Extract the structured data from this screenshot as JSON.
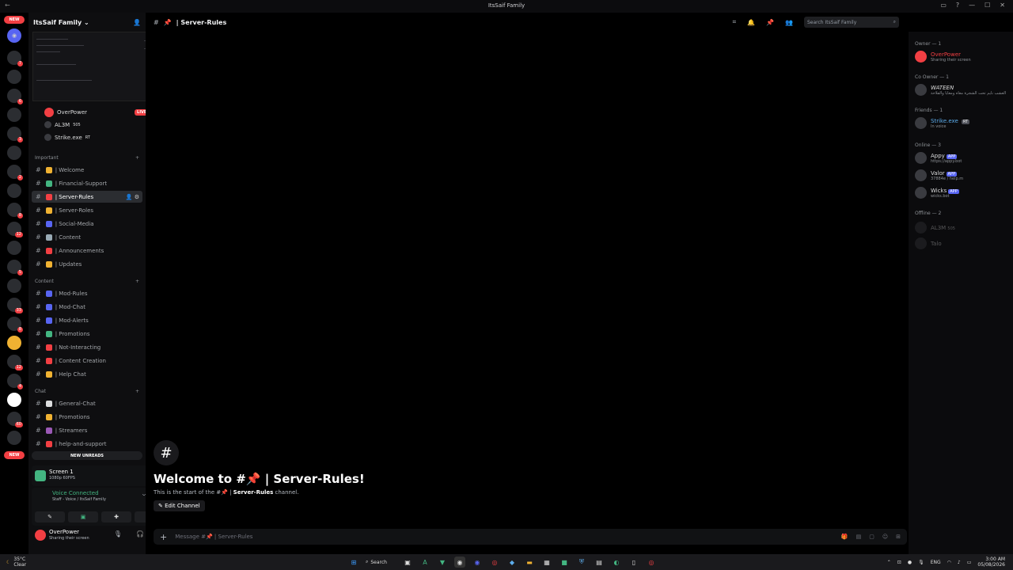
{
  "window": {
    "title": "ItsSaif Family"
  },
  "guilds": {
    "top_badge": "NEW",
    "bottom_badge": "NEW",
    "badges": [
      "7",
      "6",
      "3",
      "2",
      "8",
      "12",
      "5",
      "33",
      "8",
      "12",
      "4",
      "60"
    ]
  },
  "server": {
    "name": "ItsSaif Family"
  },
  "voice_users": [
    {
      "name": "OverPower",
      "badge": "LIVE"
    },
    {
      "name": "AL3M",
      "tag": "505"
    },
    {
      "name": "Strike.exe",
      "tag": "RT"
    }
  ],
  "categories": {
    "important": "Important",
    "content": "Content",
    "chat": "Chat"
  },
  "channels_important": [
    {
      "label": "| Welcome",
      "color": "#f0b232"
    },
    {
      "label": "| Financial-Support",
      "color": "#43b581"
    },
    {
      "label": "| Server-Rules",
      "color": "#f23f43",
      "active": true
    },
    {
      "label": "| Server-Roles",
      "color": "#f0b232"
    },
    {
      "label": "| Social-Media",
      "color": "#5865f2"
    },
    {
      "label": "| Content",
      "color": "#99aab5"
    },
    {
      "label": "| Announcements",
      "color": "#f23f43"
    },
    {
      "label": "| Updates",
      "color": "#f0b232"
    }
  ],
  "channels_content": [
    {
      "label": "| Mod-Rules",
      "color": "#5865f2"
    },
    {
      "label": "| Mod-Chat",
      "color": "#5865f2"
    },
    {
      "label": "| Mod-Alerts",
      "color": "#5865f2"
    },
    {
      "label": "| Promotions",
      "color": "#43b581"
    },
    {
      "label": "| Not-Interacting",
      "color": "#f23f43"
    },
    {
      "label": "| Content Creation",
      "color": "#f23f43"
    },
    {
      "label": "| Help Chat",
      "color": "#f0b232"
    }
  ],
  "channels_chat": [
    {
      "label": "| General-Chat",
      "color": "#dcddde"
    },
    {
      "label": "| Promotions",
      "color": "#f0b232"
    },
    {
      "label": "| Streamers",
      "color": "#9b59b6"
    },
    {
      "label": "| help-and-support",
      "color": "#f23f43"
    }
  ],
  "new_unreads": "NEW UNREADS",
  "screen_share": {
    "title": "Screen 1",
    "sub": "1080p 60FPS"
  },
  "voice_connected": {
    "status": "Voice Connected",
    "path": "Staff - Voice / ItsSaif Family"
  },
  "user_panel": {
    "name": "OverPower",
    "status": "Sharing their screen"
  },
  "channel": {
    "name": "| Server-Rules",
    "search_placeholder": "Search ItsSaif Family"
  },
  "welcome": {
    "heading": "Welcome to #📌 | Server-Rules!",
    "sub_prefix": "This is the start of the #📌 |",
    "sub_channel": "Server-Rules",
    "sub_suffix": "channel.",
    "edit": "Edit Channel"
  },
  "composer": {
    "placeholder": "Message #📌 | Server-Rules"
  },
  "members": {
    "owner_cat": "Owner — 1",
    "coowner_cat": "Co Owner — 1",
    "friends_cat": "Friends — 1",
    "online_cat": "Online — 3",
    "offline_cat": "Offline — 2",
    "owner": {
      "name": "OverPower",
      "status": "Sharing their screen",
      "color": "#f23f43"
    },
    "coowner": {
      "name": "WATEEN",
      "status": "العشب نايم تحت الشجرة معاه ومعايا والفلاحة"
    },
    "friend": {
      "name": "Strike.exe",
      "tag": "RT",
      "status": "In voice",
      "color": "#5dadec"
    },
    "online": [
      {
        "name": "Appy",
        "tag": "APP",
        "status": "https://appy.bot"
      },
      {
        "name": "Valor",
        "tag": "APP",
        "status": "37884e / help.m"
      },
      {
        "name": "Wicks",
        "tag": "APP",
        "status": "wicks.bot"
      }
    ],
    "offline": [
      {
        "name": "AL3M",
        "tag": "505"
      },
      {
        "name": "Talo",
        "tag": ""
      }
    ]
  },
  "taskbar": {
    "weather_temp": "35°C",
    "weather_text": "Clear",
    "search": "Search",
    "lang": "ENG",
    "time": "3:00 AM",
    "date": "05/08/2026"
  }
}
